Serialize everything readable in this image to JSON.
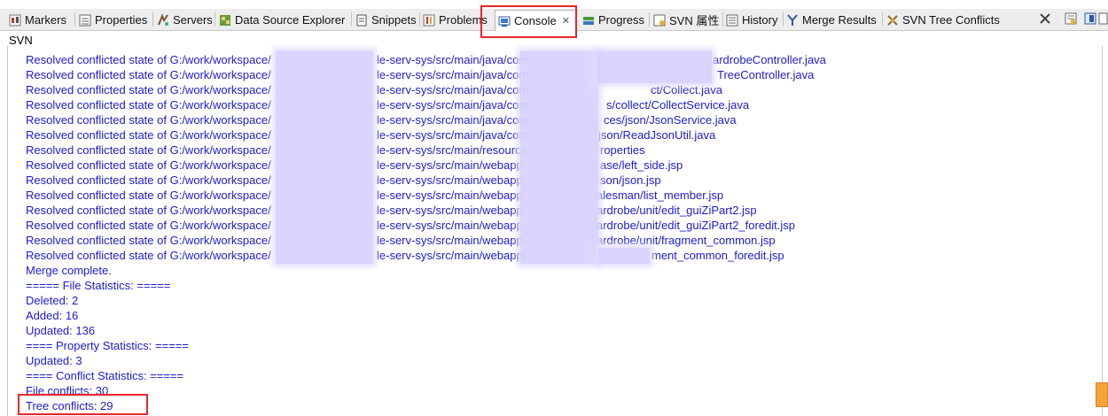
{
  "tabs": [
    {
      "label": "Markers",
      "icon": "markers-icon"
    },
    {
      "label": "Properties",
      "icon": "properties-icon"
    },
    {
      "label": "Servers",
      "icon": "servers-icon"
    },
    {
      "label": "Data Source Explorer",
      "icon": "data-source-icon"
    },
    {
      "label": "Snippets",
      "icon": "snippets-icon"
    },
    {
      "label": "Problems",
      "icon": "problems-icon"
    },
    {
      "label": "Console",
      "icon": "console-icon",
      "active": true
    },
    {
      "label": "Progress",
      "icon": "progress-icon"
    },
    {
      "label": "SVN 属性",
      "icon": "svn-properties-icon"
    },
    {
      "label": "History",
      "icon": "history-icon"
    },
    {
      "label": "Merge Results",
      "icon": "merge-results-icon"
    },
    {
      "label": "SVN Tree Conflicts",
      "icon": "svn-tree-conflicts-icon"
    }
  ],
  "console_name": "SVN",
  "lines": [
    "Resolved conflicted state of G:/work/workspace/",
    "Resolved conflicted state of G:/work/workspace/",
    "Resolved conflicted state of G:/work/workspace/",
    "Resolved conflicted state of G:/work/workspace/",
    "Resolved conflicted state of G:/work/workspace/",
    "Resolved conflicted state of G:/work/workspace/",
    "Resolved conflicted state of G:/work/workspace/",
    "Resolved conflicted state of G:/work/workspace/",
    "Resolved conflicted state of G:/work/workspace/",
    "Resolved conflicted state of G:/work/workspace/",
    "Resolved conflicted state of G:/work/workspace/",
    "Resolved conflicted state of G:/work/workspace/",
    "Resolved conflicted state of G:/work/workspace/",
    "Resolved conflicted state of G:/work/workspace/",
    "Merge complete.",
    "===== File Statistics: =====",
    "Deleted: 2",
    "Added: 16",
    "Updated: 136",
    "==== Property Statistics: =====",
    "Updated: 3",
    "==== Conflict Statistics: =====",
    "File conflicts: 30",
    "Tree conflicts: 29"
  ],
  "mid_fragments": [
    "le-serv-sys/src/main/java/com",
    "le-serv-sys/src/main/java/com",
    "le-serv-sys/src/main/java/com",
    "le-serv-sys/src/main/java/com",
    "le-serv-sys/src/main/java/com",
    "le-serv-sys/src/main/java/com",
    "le-serv-sys/src/main/resource",
    "le-serv-sys/src/main/webapp",
    "le-serv-sys/src/main/webapp",
    "le-serv-sys/src/main/webapp",
    "le-serv-sys/src/main/webapp",
    "le-serv-sys/src/main/webapp",
    "le-serv-sys/src/main/webapp",
    "le-serv-sys/src/main/webapp/"
  ],
  "end_fragments": [
    "ardrobeController.java",
    "TreeController.java",
    "ct/Collect.java",
    "s/collect/CollectService.java",
    "ces/json/JsonService.java",
    "json/ReadJsonUtil.java",
    "roperties",
    "ase/left_side.jsp",
    "son/json.jsp",
    "alesman/list_member.jsp",
    "ardrobe/unit/edit_guiZiPart2.jsp",
    "ardrobe/unit/edit_guiZiPart2_foredit.jsp",
    "ardrobe/unit/fragment_common.jsp",
    "ment_common_foredit.jsp"
  ],
  "colors": {
    "console_text": "#1b1bd4",
    "highlight": "#e8262a",
    "tab_bar": "#ededed"
  }
}
